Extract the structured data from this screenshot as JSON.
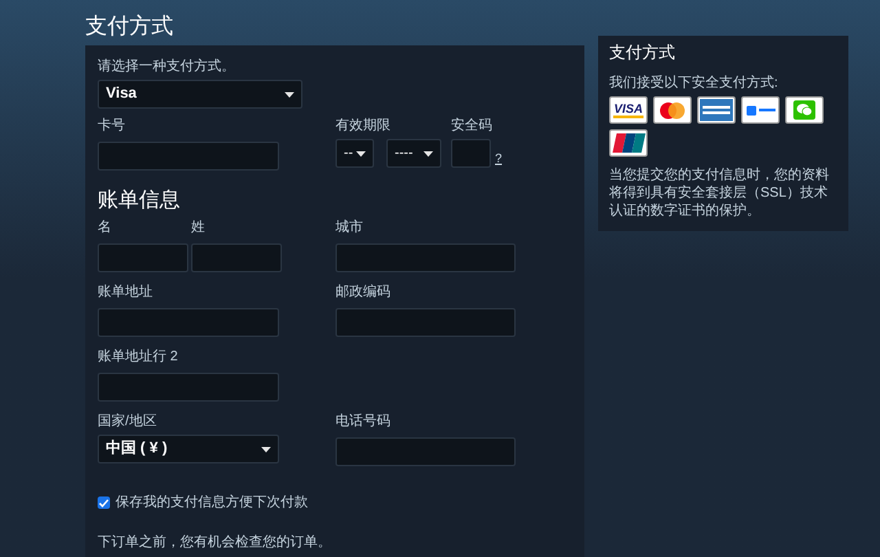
{
  "page_title": "支付方式",
  "payment": {
    "method_label": "请选择一种支付方式。",
    "method_value": "Visa",
    "card_number_label": "卡号",
    "expiry_label": "有效期限",
    "expiry_month": "--",
    "expiry_year": "----",
    "cvv_label": "安全码",
    "cvv_help": "?"
  },
  "billing": {
    "heading": "账单信息",
    "first_name_label": "名",
    "last_name_label": "姓",
    "city_label": "城市",
    "address_label": "账单地址",
    "postcode_label": "邮政编码",
    "address2_label": "账单地址行 2",
    "country_label": "国家/地区",
    "country_value": "中国 ( ¥ )",
    "phone_label": "电话号码"
  },
  "save_info": {
    "label": "保存我的支付信息方便下次付款",
    "checked": true
  },
  "footer_note": "下订单之前，您有机会检查您的订单。",
  "sidebar": {
    "title": "支付方式",
    "intro": "我们接受以下安全支付方式:",
    "cards": [
      {
        "kind": "visa",
        "label": "VISA"
      },
      {
        "kind": "mastercard"
      },
      {
        "kind": "amex"
      },
      {
        "kind": "alipay"
      },
      {
        "kind": "wechat"
      },
      {
        "kind": "unionpay"
      }
    ],
    "note": "当您提交您的支付信息时，您的资料将得到具有安全套接层（SSL）技术认证的数字证书的保护。"
  }
}
